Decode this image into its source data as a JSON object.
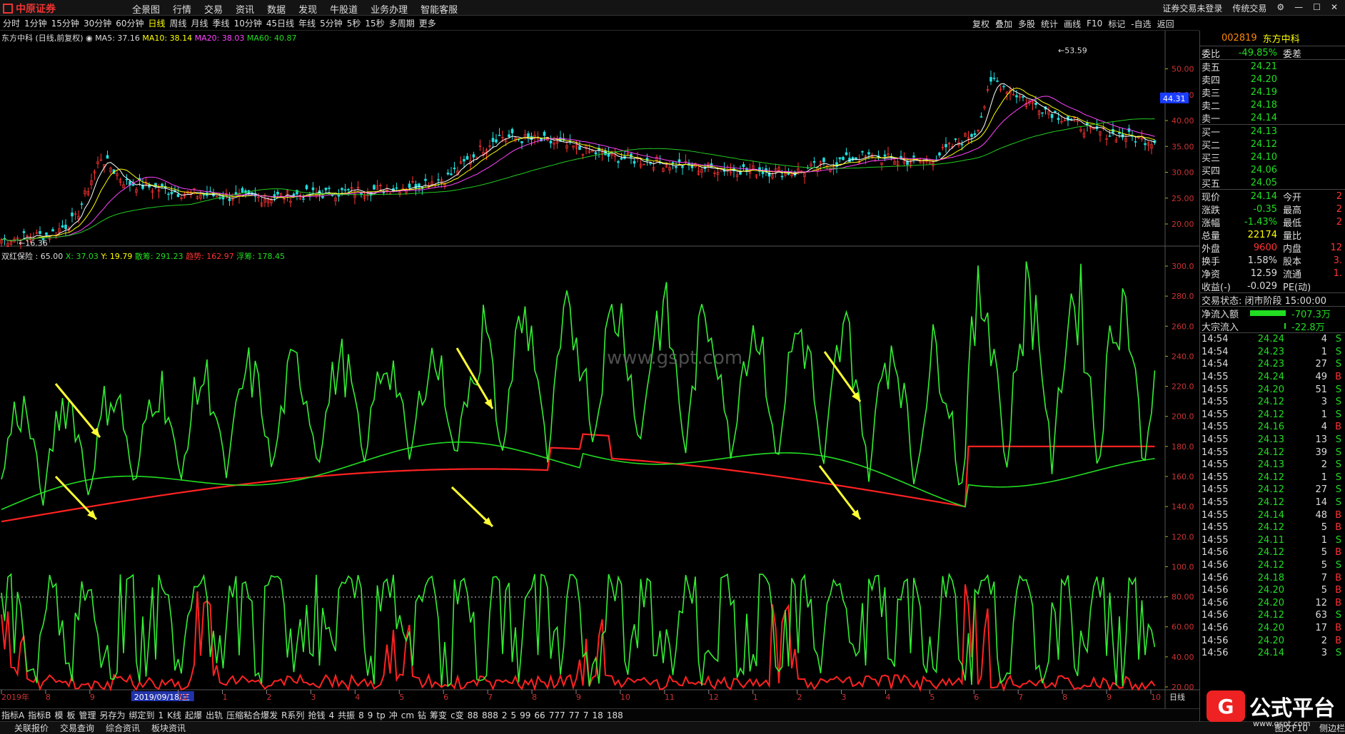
{
  "app": {
    "logo_text": "中原证券",
    "window_right": [
      "证券交易未登录",
      "传统交易"
    ]
  },
  "top_menu": [
    "全景图",
    "行情",
    "交易",
    "资讯",
    "数据",
    "发现",
    "牛股道",
    "业务办理",
    "智能客服"
  ],
  "period_bar": [
    "分时",
    "1分钟",
    "15分钟",
    "30分钟",
    "60分钟",
    "日线",
    "周线",
    "月线",
    "季线",
    "10分钟",
    "45日线",
    "年线",
    "5分钟",
    "5秒",
    "15秒",
    "多周期",
    "更多"
  ],
  "period_selected": "日线",
  "tools": [
    "复权",
    "叠加",
    "多股",
    "统计",
    "画线",
    "F10",
    "标记",
    "-自选",
    "返回"
  ],
  "kline": {
    "title": "东方中科 (日线,前复权)",
    "ma5": "MA5: 37.16",
    "ma10": "MA10: 38.14",
    "ma20": "MA20: 38.03",
    "ma60": "MA60: 40.87",
    "high_label": "53.59",
    "low_label": "16.36",
    "price_tag": "44.31",
    "ticks": [
      "50.00",
      "45.00",
      "40.00",
      "35.00",
      "30.00",
      "25.00",
      "20.00"
    ]
  },
  "indicator1": {
    "title": "双红保险 : 65.00",
    "x": "X: 37.03",
    "y": "Y: 19.79",
    "sanchou": "散筹: 291.23",
    "qushi": "趋势: 162.97",
    "fuchou": "浮筹: 178.45",
    "ticks": [
      "300.0",
      "280.0",
      "260.0",
      "240.0",
      "220.0",
      "200.0",
      "180.0",
      "160.0",
      "140.0",
      "120.0",
      "100.0",
      "80.00",
      "60.00",
      "40.00",
      "20.00"
    ]
  },
  "date_axis": {
    "labels": [
      "2019年",
      "8",
      "9",
      "2019/09/18/三",
      "12",
      "1",
      "2",
      "3",
      "4",
      "5",
      "6",
      "7",
      "8",
      "9",
      "10",
      "11",
      "12",
      "1",
      "2",
      "3",
      "4",
      "5",
      "6",
      "7",
      "8",
      "9",
      "10"
    ],
    "right_label": "日线"
  },
  "bottom_tabs": [
    "指标A",
    "指标B",
    "模",
    "板",
    "管理",
    "另存为",
    "绑定到",
    "1",
    "K线",
    "起爆",
    "出轨",
    "压缩粘合爆发",
    "R系列",
    "抢钱",
    "4",
    "共振",
    "8",
    "9",
    "tp",
    "冲",
    "cm",
    "钻",
    "筹变",
    "c变",
    "88",
    "888",
    "2",
    "5",
    "99",
    "66",
    "777",
    "77",
    "7",
    "18",
    "188"
  ],
  "status_tabs": [
    "关联报价",
    "交易查询",
    "综合资讯",
    "板块资讯"
  ],
  "status_right": [
    "图文F10",
    "侧边栏"
  ],
  "quote": {
    "code": "002819",
    "name": "东方中科",
    "weibi_label": "委比",
    "weibi": "-49.85%",
    "weicha_label": "委差",
    "asks": [
      {
        "l": "卖五",
        "p": "24.21"
      },
      {
        "l": "卖四",
        "p": "24.20"
      },
      {
        "l": "卖三",
        "p": "24.19"
      },
      {
        "l": "卖二",
        "p": "24.18"
      },
      {
        "l": "卖一",
        "p": "24.14"
      }
    ],
    "bids": [
      {
        "l": "买一",
        "p": "24.13"
      },
      {
        "l": "买二",
        "p": "24.12"
      },
      {
        "l": "买三",
        "p": "24.10"
      },
      {
        "l": "买四",
        "p": "24.06"
      },
      {
        "l": "买五",
        "p": "24.05"
      }
    ],
    "stats": [
      {
        "l": "现价",
        "v": "24.14",
        "c": "g",
        "l2": "今开",
        "v2": "2"
      },
      {
        "l": "涨跌",
        "v": "-0.35",
        "c": "g",
        "l2": "最高",
        "v2": "2"
      },
      {
        "l": "涨幅",
        "v": "-1.43%",
        "c": "g",
        "l2": "最低",
        "v2": "2"
      },
      {
        "l": "总量",
        "v": "22174",
        "c": "y",
        "l2": "量比",
        "v2": ""
      },
      {
        "l": "外盘",
        "v": "9600",
        "c": "r",
        "l2": "内盘",
        "v2": "12"
      },
      {
        "l": "换手",
        "v": "1.58%",
        "c": "w",
        "l2": "股本",
        "v2": "3."
      },
      {
        "l": "净资",
        "v": "12.59",
        "c": "w",
        "l2": "流通",
        "v2": "1."
      },
      {
        "l": "收益(-)",
        "v": "-0.029",
        "c": "w",
        "l2": "PE(动)",
        "v2": ""
      }
    ],
    "trade_state": "交易状态: 闭市阶段 15:00:00",
    "netflow_label": "净流入额",
    "netflow": "-707.3万",
    "block_label": "大宗流入",
    "block": "-22.8万",
    "ticks": [
      [
        "14:54",
        "24.24",
        "4",
        "S"
      ],
      [
        "14:54",
        "24.23",
        "1",
        "S"
      ],
      [
        "14:54",
        "24.23",
        "27",
        "S"
      ],
      [
        "14:55",
        "24.24",
        "49",
        "B"
      ],
      [
        "14:55",
        "24.20",
        "51",
        "S"
      ],
      [
        "14:55",
        "24.12",
        "3",
        "S"
      ],
      [
        "14:55",
        "24.12",
        "1",
        "S"
      ],
      [
        "14:55",
        "24.16",
        "4",
        "B"
      ],
      [
        "14:55",
        "24.13",
        "13",
        "S"
      ],
      [
        "14:55",
        "24.12",
        "39",
        "S"
      ],
      [
        "14:55",
        "24.13",
        "2",
        "S"
      ],
      [
        "14:55",
        "24.12",
        "1",
        "S"
      ],
      [
        "14:55",
        "24.12",
        "27",
        "S"
      ],
      [
        "14:55",
        "24.12",
        "14",
        "S"
      ],
      [
        "14:55",
        "24.14",
        "48",
        "B"
      ],
      [
        "14:55",
        "24.12",
        "5",
        "B"
      ],
      [
        "14:55",
        "24.11",
        "1",
        "S"
      ],
      [
        "14:56",
        "24.12",
        "5",
        "B"
      ],
      [
        "14:56",
        "24.12",
        "5",
        "S"
      ],
      [
        "14:56",
        "24.18",
        "7",
        "B"
      ],
      [
        "14:56",
        "24.20",
        "5",
        "B"
      ],
      [
        "14:56",
        "24.20",
        "12",
        "B"
      ],
      [
        "14:56",
        "24.12",
        "63",
        "S"
      ],
      [
        "14:56",
        "24.20",
        "17",
        "B"
      ],
      [
        "14:56",
        "24.20",
        "2",
        "B"
      ],
      [
        "14:56",
        "24.14",
        "3",
        "S"
      ]
    ]
  },
  "watermark": "www.gspt.com",
  "brand": {
    "mark": "G",
    "text": "公式平台",
    "url": "www.gspt.com"
  },
  "colors": {
    "up": "#ff3333",
    "down": "#22dd22",
    "ma5": "#ffffff",
    "ma10": "#ffff00",
    "ma20": "#ff44ff",
    "ma60": "#22cc22",
    "arrow": "#ffff33"
  }
}
